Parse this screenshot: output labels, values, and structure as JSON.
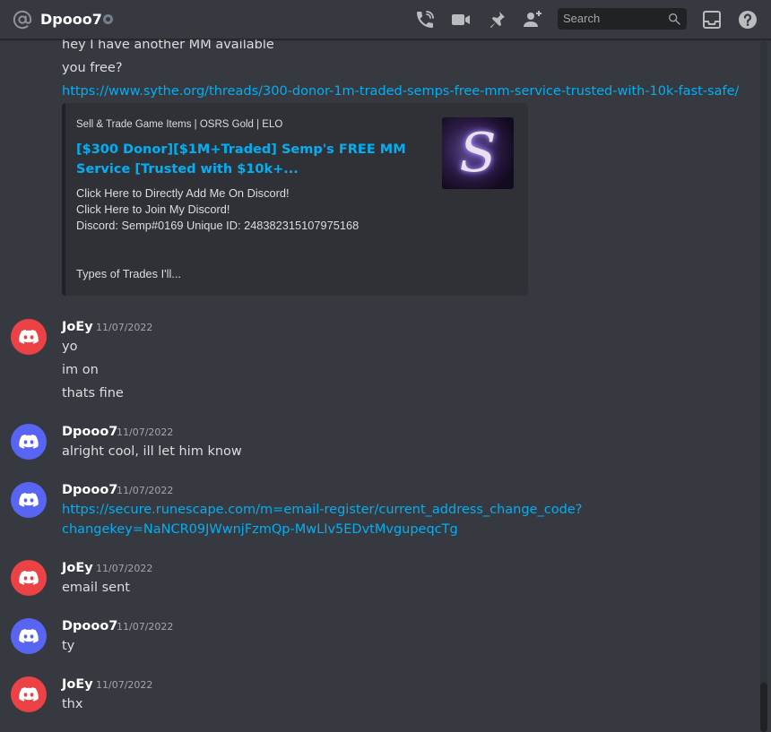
{
  "header": {
    "channel_name": "Dpooo7",
    "search_placeholder": "Search",
    "icons": [
      "at-icon",
      "status-offline-icon",
      "start-voice-call-icon",
      "start-video-call-icon",
      "pinned-messages-icon",
      "add-friends-icon",
      "search-icon",
      "inbox-icon",
      "help-icon"
    ]
  },
  "colors": {
    "background": "#36393f",
    "header_bg": "#36393f",
    "link": "#00aff4",
    "avatar_red": "#ed4245",
    "avatar_blurple": "#5865f2",
    "embed_bg": "#2f3136",
    "embed_border": "#202225"
  },
  "top_messages": {
    "line1": "hey I have another MM available",
    "line2": "you free?",
    "link": "https://www.sythe.org/threads/300-donor-1m-traded-semps-free-mm-service-trusted-with-10k-fast-safe/"
  },
  "embed": {
    "provider": "Sell & Trade Game Items | OSRS Gold | ELO",
    "title": "[$300 Donor][$1M+Traded] Semp's FREE MM Service [Trusted with $10k+...",
    "description": "Click Here to Directly Add Me On Discord!\nClick Here to Join My Discord!\nDiscord: Semp#0169 Unique ID: 248382315107975168",
    "description_more": "Types of Trades I'll...",
    "thumbnail_letter": "S"
  },
  "groups": [
    {
      "username": "JoEy",
      "timestamp": "11/07/2022",
      "avatar": "red",
      "lines": [
        "yo",
        "im on",
        "thats fine"
      ]
    },
    {
      "username": "Dpooo7",
      "timestamp": "11/07/2022",
      "avatar": "blurple",
      "lines": [
        "alright cool, ill let him know"
      ]
    },
    {
      "username": "Dpooo7",
      "timestamp": "11/07/2022",
      "avatar": "blurple",
      "link_lines": [
        "https://secure.runescape.com/m=email-register/current_address_change_code?",
        "changekey=NaNCR09JWwnjFzmQp-MwLIv5EDvtMvgupeqcTg"
      ]
    },
    {
      "username": "JoEy",
      "timestamp": "11/07/2022",
      "avatar": "red",
      "lines": [
        "email sent"
      ]
    },
    {
      "username": "Dpooo7",
      "timestamp": "11/07/2022",
      "avatar": "blurple",
      "lines": [
        "ty"
      ]
    },
    {
      "username": "JoEy",
      "timestamp": "11/07/2022",
      "avatar": "red",
      "lines": [
        "thx"
      ]
    }
  ]
}
